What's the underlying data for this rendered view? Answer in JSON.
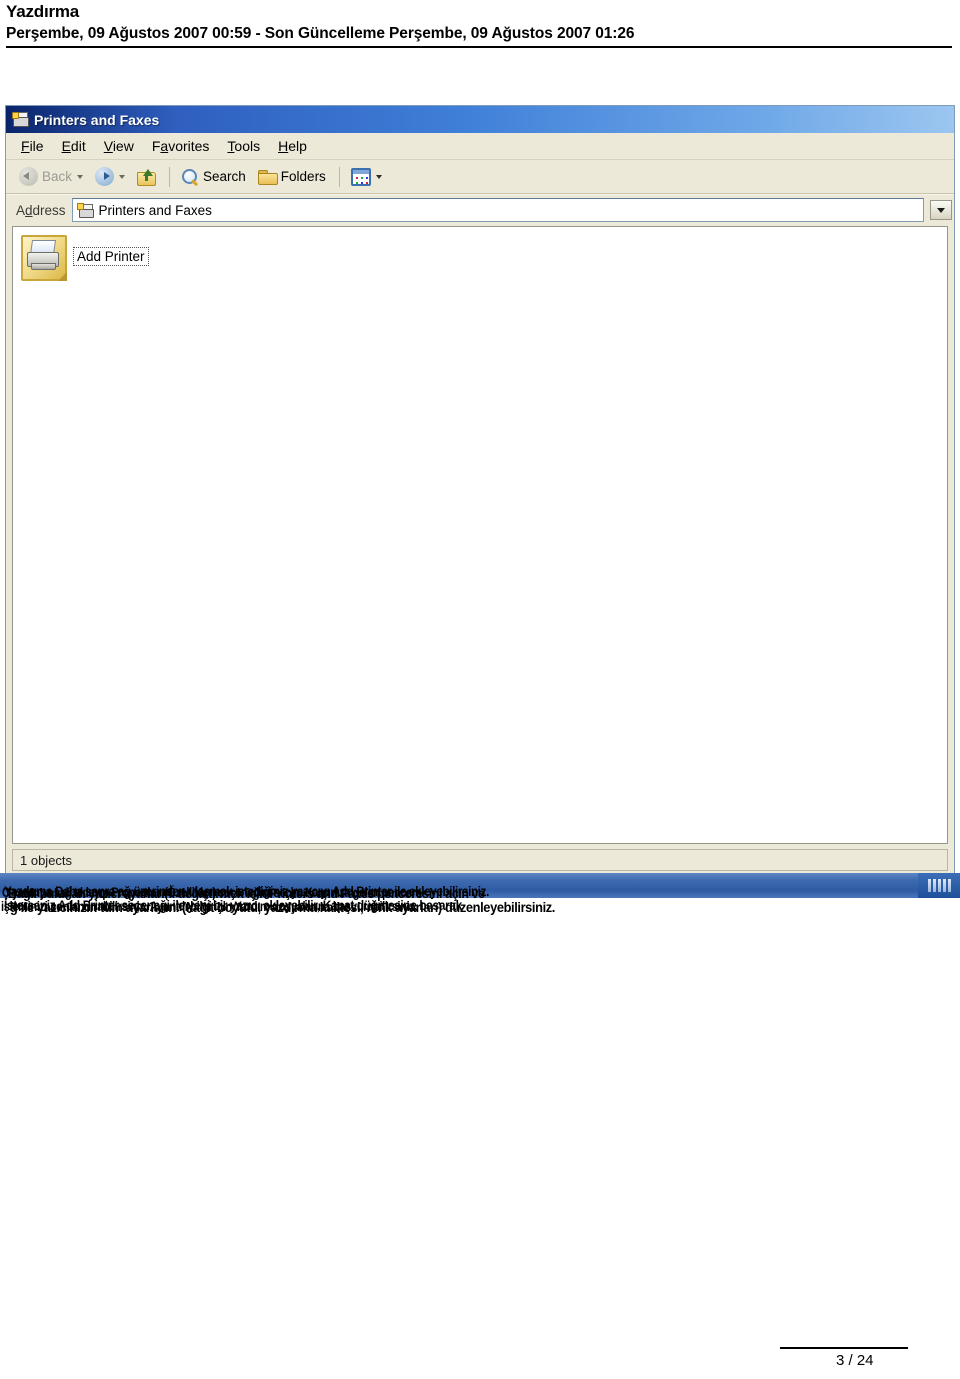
{
  "document": {
    "title": "Yazdırma",
    "subtitle": "Perşembe, 09 Ağustos 2007 00:59 - Son Güncelleme Perşembe, 09 Ağustos 2007 01:26",
    "footer_page": "3 / 24"
  },
  "screenshot": {
    "window": {
      "title": "Printers and Faxes",
      "title_icon": "printers-and-faxes-icon"
    },
    "menubar": [
      {
        "label": "File",
        "accel": "F"
      },
      {
        "label": "Edit",
        "accel": "E"
      },
      {
        "label": "View",
        "accel": "V"
      },
      {
        "label": "Favorites",
        "accel": "a"
      },
      {
        "label": "Tools",
        "accel": "T"
      },
      {
        "label": "Help",
        "accel": "H"
      }
    ],
    "toolbar": {
      "back_label": "Back",
      "forward_label": "",
      "up_label": "",
      "search_label": "Search",
      "folders_label": "Folders",
      "views_label": ""
    },
    "addressbar": {
      "label": "Address",
      "accel": "d",
      "value": "Printers and Faxes"
    },
    "content": {
      "items": [
        {
          "label": "Add Printer",
          "icon": "add-printer-wizard-icon",
          "selected": true
        }
      ]
    },
    "statusbar": {
      "text": "1 objects"
    }
  },
  "caption": {
    "overlapped_lines": [
      "Yazdırma Daha sonra ağ üzerinden ulaşmak istediğiniz yazıcıyı Add Printer ile ekleyebilirsiniz.",
      "Bağlı bulunan yazıcı ayarlarını değiştirmek için Printers and Faxes penceresini açın ve",
      "Ç yazıcıya sağ tıklayıp Properties (Özellikler) seçeneğini seçin. Karşınıza gelen pencere",
      "İsterseniz Add Printer seçeneği ile yeni bir yazıcı ekleyebilir, Kapat düğmesine basarak",
      "ğ ile yazıcınızın tüm ayarlarını (kağıt boyutu, yazdırma kalitesi, renk ayarları) düzenleyebilirsiniz.",
      "işleminizi sonlandırabilirsiniz. Ayrıntılı bilgi için Yardım dosyalarına başvurabilirsiniz."
    ]
  }
}
